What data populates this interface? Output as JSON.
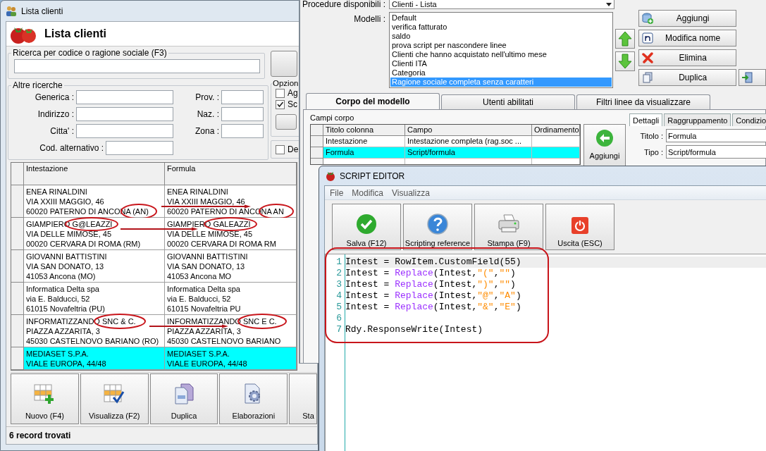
{
  "client_list_window": {
    "title": "Lista clienti",
    "header_title": "Lista clienti",
    "search_group": {
      "label": "Ricerca per codice o ragione sociale (F3)"
    },
    "other_search": {
      "label": "Altre ricerche",
      "fields": [
        {
          "label": "Generica :"
        },
        {
          "label": "Prov. :"
        },
        {
          "label": "Indirizzo :"
        },
        {
          "label": "Naz. :"
        },
        {
          "label": "Citta' :"
        },
        {
          "label": "Zona :"
        }
      ],
      "alt_code_field": {
        "label": "Cod. alternativo :"
      }
    },
    "options": {
      "label": "Opzion",
      "checkboxes": [
        {
          "label": "Ag",
          "checked": false
        },
        {
          "label": "Sc",
          "checked": true
        }
      ]
    },
    "extra_checkbox": {
      "label": "De",
      "checked": false
    },
    "table": {
      "columns": [
        "Intestazione",
        "Formula"
      ],
      "rows": [
        {
          "cells": [
            "ENEA RINALDINI\nVIA XXIII MAGGIO, 46\n60020 PATERNO DI ANCONA (AN)",
            "ENEA RINALDINI\nVIA XXIII MAGGIO, 46\n60020 PATERNO DI ANCONA AN"
          ],
          "selected": false
        },
        {
          "cells": [
            "GIAMPIERO G@LEAZZI\nVIA DELLE MIMOSE, 45\n00020 CERVARA DI ROMA (RM)",
            "GIAMPIERO GALEAZZI\nVIA DELLE MIMOSE, 45\n00020 CERVARA DI ROMA RM"
          ],
          "selected": false
        },
        {
          "cells": [
            "GIOVANNI BATTISTINI\nVIA SAN DONATO, 13\n41053 Ancona (MO)",
            "GIOVANNI BATTISTINI\nVIA SAN DONATO, 13\n41053 Ancona MO"
          ],
          "selected": false
        },
        {
          "cells": [
            "Informatica Delta spa\nvia E. Balducci, 52\n61015 Novafeltria (PU)",
            "Informatica Delta spa\nvia E. Balducci, 52\n61015 Novafeltria PU"
          ],
          "selected": false
        },
        {
          "cells": [
            "INFORMATIZZANDO SNC & C.\nPIAZZA AZZARITA, 3\n45030 CASTELNOVO BARIANO (RO)",
            "INFORMATIZZANDO SNC E C.\nPIAZZA AZZARITA, 3\n45030 CASTELNOVO BARIANO"
          ],
          "selected": false
        },
        {
          "cells": [
            "MEDIASET S.P.A.\nVIALE EUROPA, 44/48",
            "MEDIASET S.P.A.\nVIALE EUROPA, 44/48"
          ],
          "selected": true
        }
      ]
    },
    "toolbar": [
      "Nuovo (F4)",
      "Visualizza (F2)",
      "Duplica",
      "Elaborazioni",
      "Sta"
    ],
    "status": "6 record trovati"
  },
  "model_window": {
    "procedure_label": "Procedure disponibili :",
    "procedure_value": "Clienti - Lista",
    "models_label": "Modelli :",
    "models": [
      {
        "label": "Default",
        "selected": false
      },
      {
        "label": "verifica fatturato",
        "selected": false
      },
      {
        "label": "saldo",
        "selected": false
      },
      {
        "label": "prova script per nascondere linee",
        "selected": false
      },
      {
        "label": "Clienti che hanno acquistato nell'ultimo mese",
        "selected": false
      },
      {
        "label": "Clienti ITA",
        "selected": false
      },
      {
        "label": "Categoria",
        "selected": false
      },
      {
        "label": "Ragione sociale completa senza caratteri",
        "selected": true
      }
    ],
    "buttons": [
      "Aggiungi",
      "Modifica nome",
      "Elimina",
      "Duplica"
    ],
    "tabs": [
      {
        "label": "Corpo del modello",
        "selected": true
      },
      {
        "label": "Utenti abilitati",
        "selected": false
      },
      {
        "label": "Filtri linee da visualizzare",
        "selected": false
      }
    ],
    "fields_label": "Campi corpo",
    "fields_table": {
      "columns": [
        "Titolo colonna",
        "Campo",
        "Ordinamento"
      ],
      "rows": [
        {
          "cells": [
            "Intestazione",
            "Intestazione completa (rag.soc ..."
          ],
          "selected": false
        },
        {
          "cells": [
            "Formula",
            "Script/formula"
          ],
          "selected": true
        }
      ]
    },
    "add_button": "Aggiungi",
    "detail_tabs": [
      {
        "label": "Dettagli",
        "selected": true
      },
      {
        "label": "Raggruppamento",
        "selected": false
      },
      {
        "label": "Condizio",
        "selected": false
      }
    ],
    "detail_fields": [
      {
        "label": "Titolo :",
        "value": "Formula"
      },
      {
        "label": "Tipo :",
        "value": "Script/formula"
      }
    ]
  },
  "script_editor": {
    "title": "SCRIPT EDITOR",
    "menu": [
      "File",
      "Modifica",
      "Visualizza"
    ],
    "toolbar": [
      "Salva (F12)",
      "Scripting reference",
      "Stampa (F9)",
      "Uscita (ESC)"
    ],
    "lines": [
      {
        "number": "1",
        "selected": true,
        "tokens": [
          {
            "kind": "plain",
            "text": "Intest = RowItem.CustomField(55)"
          }
        ]
      },
      {
        "number": "2",
        "selected": false,
        "tokens": [
          {
            "kind": "plain",
            "text": "Intest = "
          },
          {
            "kind": "keyword",
            "text": "Replace"
          },
          {
            "kind": "plain",
            "text": "(Intest,"
          },
          {
            "kind": "string",
            "text": "\"(\""
          },
          {
            "kind": "plain",
            "text": ","
          },
          {
            "kind": "string",
            "text": "\"\""
          },
          {
            "kind": "plain",
            "text": ")"
          }
        ]
      },
      {
        "number": "3",
        "selected": false,
        "tokens": [
          {
            "kind": "plain",
            "text": "Intest = "
          },
          {
            "kind": "keyword",
            "text": "Replace"
          },
          {
            "kind": "plain",
            "text": "(Intest,"
          },
          {
            "kind": "string",
            "text": "\")\""
          },
          {
            "kind": "plain",
            "text": ","
          },
          {
            "kind": "string",
            "text": "\"\""
          },
          {
            "kind": "plain",
            "text": ")"
          }
        ]
      },
      {
        "number": "4",
        "selected": false,
        "tokens": [
          {
            "kind": "plain",
            "text": "Intest = "
          },
          {
            "kind": "keyword",
            "text": "Replace"
          },
          {
            "kind": "plain",
            "text": "(Intest,"
          },
          {
            "kind": "string",
            "text": "\"@\""
          },
          {
            "kind": "plain",
            "text": ","
          },
          {
            "kind": "string",
            "text": "\"A\""
          },
          {
            "kind": "plain",
            "text": ")"
          }
        ]
      },
      {
        "number": "5",
        "selected": false,
        "tokens": [
          {
            "kind": "plain",
            "text": "Intest = "
          },
          {
            "kind": "keyword",
            "text": "Replace"
          },
          {
            "kind": "plain",
            "text": "(Intest,"
          },
          {
            "kind": "string",
            "text": "\"&\""
          },
          {
            "kind": "plain",
            "text": ","
          },
          {
            "kind": "string",
            "text": "\"E\""
          },
          {
            "kind": "plain",
            "text": ")"
          }
        ]
      },
      {
        "number": "6",
        "selected": false
      },
      {
        "number": "7",
        "selected": false,
        "tokens": [
          {
            "kind": "plain",
            "text": "Rdy.ResponseWrite(Intest)"
          }
        ]
      }
    ]
  }
}
